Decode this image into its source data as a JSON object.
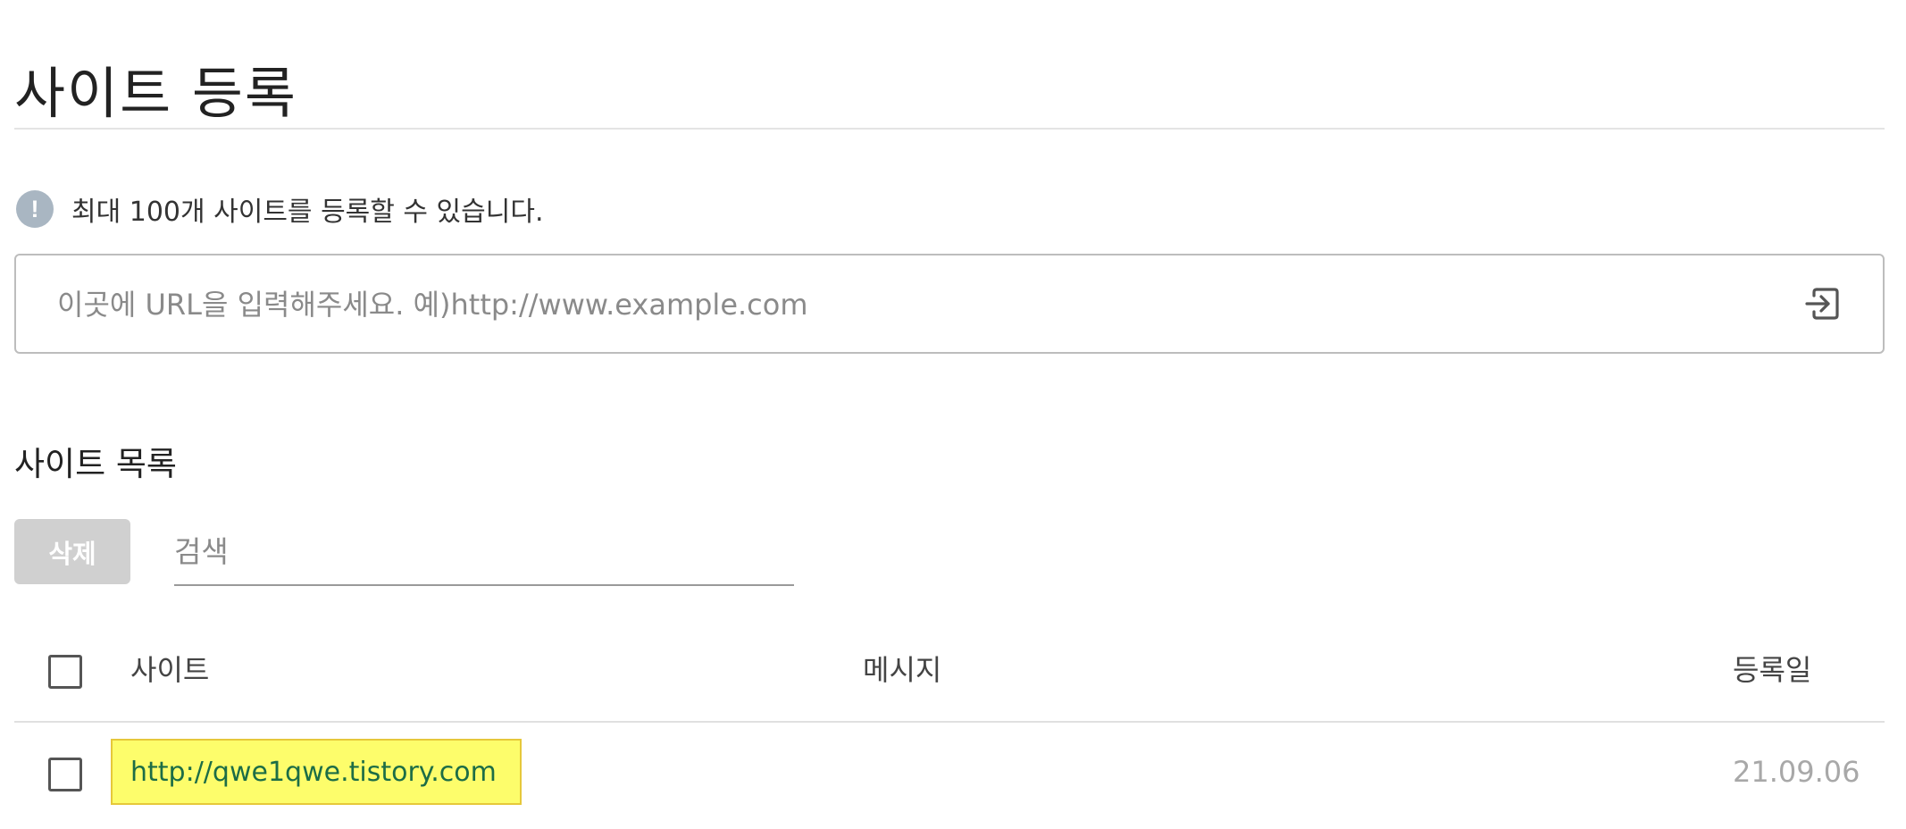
{
  "page": {
    "title": "사이트 등록"
  },
  "notice": {
    "icon": "exclamation-icon",
    "text": "최대 100개 사이트를 등록할 수 있습니다."
  },
  "url_input": {
    "placeholder": "이곳에 URL을 입력해주세요. 예)http://www.example.com",
    "value": "",
    "submit_icon": "enter-arrow-icon"
  },
  "site_list": {
    "title": "사이트 목록",
    "delete_label": "삭제",
    "search_placeholder": "검색",
    "columns": {
      "site": "사이트",
      "message": "메시지",
      "date": "등록일"
    },
    "rows": [
      {
        "checked": false,
        "site": "http://qwe1qwe.tistory.com",
        "message": "",
        "date": "21.09.06"
      }
    ]
  },
  "colors": {
    "highlight_bg": "#fdfd6b",
    "link_text": "#1c6d46",
    "delete_button_bg": "#d0d0d0",
    "info_icon_bg": "#a9b6c2"
  }
}
